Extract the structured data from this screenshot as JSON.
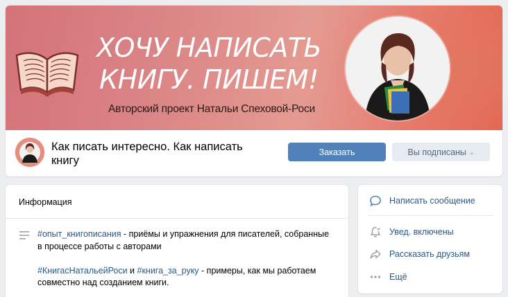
{
  "cover": {
    "headline_line1": "ХОЧУ НАПИСАТЬ",
    "headline_line2": "КНИГУ. ПИШЕМ!",
    "subtitle": "Авторский проект Натальи Спеховой-Роси"
  },
  "header": {
    "title": "Как писать интересно. Как написать книгу",
    "order_button": "Заказать",
    "subscribed_button": "Вы подписаны"
  },
  "info": {
    "heading": "Информация",
    "p1_tag": "#опыт_книгописания",
    "p1_text": " - приёмы и упражнения для писателей, собранные в процессе работы с авторами",
    "p2_tag1": "#КнигасНатальейРоси",
    "p2_and": " и ",
    "p2_tag2": "#книга_за_руку",
    "p2_text": " - примеры, как мы работаем совместно над созданием книги."
  },
  "actions": {
    "message": "Написать сообщение",
    "notifications": "Увед. включены",
    "share": "Рассказать друзьям",
    "more": "Ещё"
  },
  "colors": {
    "accent": "#5181b8",
    "link": "#2a5885",
    "secondary_button": "#e5ebf1",
    "background": "#edeef0"
  },
  "icons": [
    "book-icon",
    "menu-lines-icon",
    "chat-bubble-icon",
    "bell-check-icon",
    "share-arrow-icon",
    "more-dots-icon",
    "chevron-down-icon"
  ]
}
